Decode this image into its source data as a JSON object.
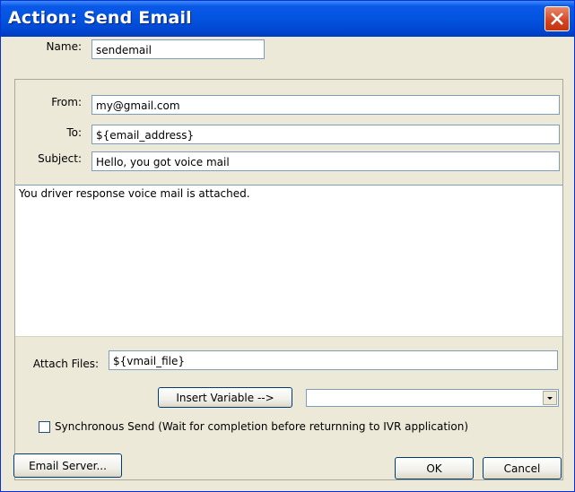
{
  "window": {
    "title": "Action: Send Email"
  },
  "name": {
    "label": "Name:",
    "value": "sendemail"
  },
  "from": {
    "label": "From:",
    "value": "my@gmail.com"
  },
  "to": {
    "label": "To:",
    "value": "${email_address}"
  },
  "subject": {
    "label": "Subject:",
    "value": "Hello, you got voice mail"
  },
  "body": {
    "value": "You driver response voice mail is attached."
  },
  "attach": {
    "label": "Attach Files:",
    "value": "${vmail_file}"
  },
  "insert_variable": {
    "label": "Insert Variable -->",
    "selected": ""
  },
  "synchronous": {
    "label": "Synchronous Send (Wait for completion before returnning to IVR application)",
    "checked": false
  },
  "buttons": {
    "email_server": "Email Server...",
    "ok": "OK",
    "cancel": "Cancel"
  },
  "icons": {
    "close": "close-icon",
    "dropdown": "chevron-down-icon"
  }
}
